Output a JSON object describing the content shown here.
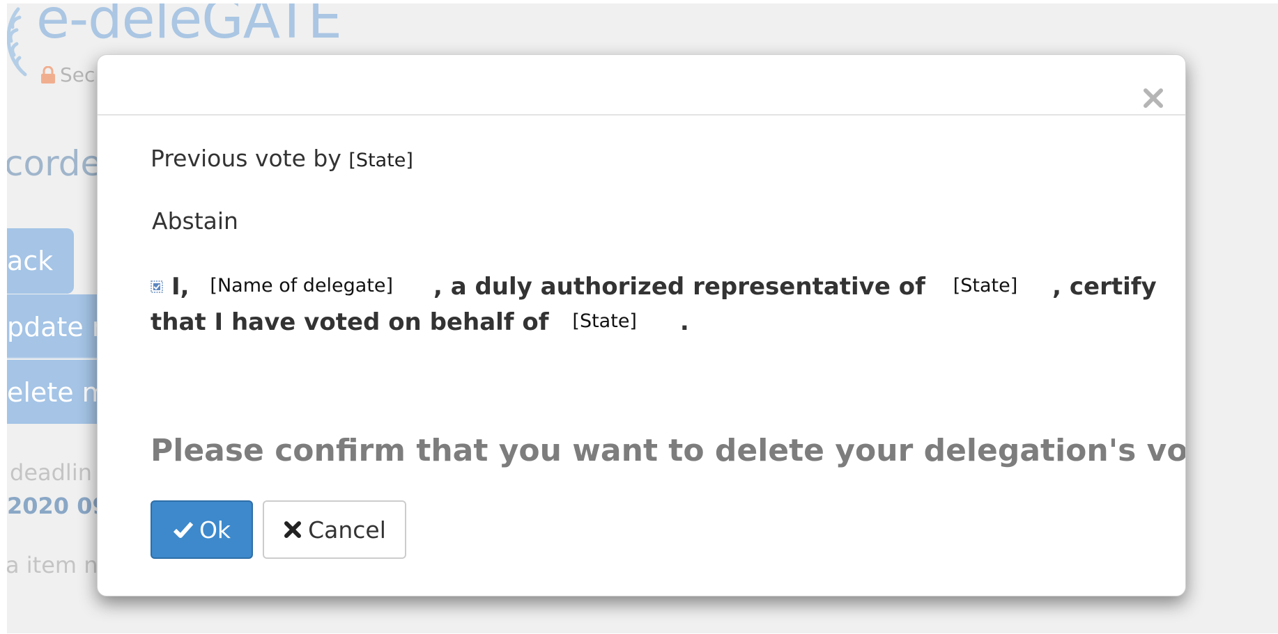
{
  "background": {
    "logo_text": "e-deleGATE",
    "secure_text": "Sec",
    "heading_fragment": "corde",
    "buttons": {
      "back": "ack",
      "update": "pdate m",
      "delete": "elete m"
    },
    "deadline_label": "deadlin",
    "deadline_value": "2020 09",
    "item_note": "a item n"
  },
  "modal": {
    "close_symbol": "×",
    "previous_vote_label": "Previous vote by",
    "previous_vote_state": "[State]",
    "vote_value": "Abstain",
    "certification": {
      "pronoun": "I,",
      "delegate_field": "[Name of delegate]",
      "text_1": ", a duly authorized representative of",
      "state_field_1": "[State]",
      "text_2": ", certify",
      "text_3": "that I have voted on behalf of",
      "state_field_2": "[State]",
      "text_end": "."
    },
    "confirm_text": "Please confirm that you want to delete your delegation's vote",
    "ok_label": "Ok",
    "cancel_label": "Cancel"
  },
  "colors": {
    "primary": "#3d89cc",
    "confirm_text": "#7d7d7d",
    "logo": "#aac6e3"
  }
}
